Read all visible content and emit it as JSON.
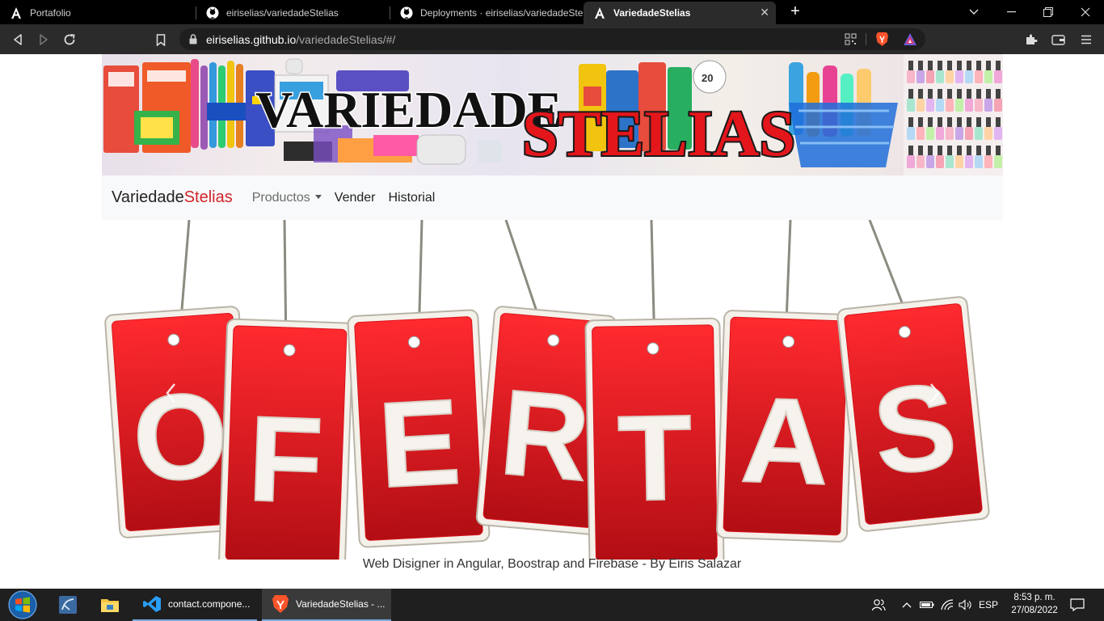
{
  "browser": {
    "tabs": [
      {
        "title": "Portafolio",
        "icon": "angular-icon",
        "active": false
      },
      {
        "title": "eiriselias/variedadeStelias",
        "icon": "github-icon",
        "active": false
      },
      {
        "title": "Deployments · eiriselias/variedadeStelias",
        "icon": "github-icon",
        "active": false
      },
      {
        "title": "VariedadeStelias",
        "icon": "angular-icon",
        "active": true
      }
    ],
    "url_host": "eiriselias.github.io",
    "url_path": "/variedadeStelias/#/"
  },
  "page": {
    "banner": {
      "word1": "VARIEDADE",
      "word2": "STELIAS",
      "small_label": "20"
    },
    "navbar": {
      "brand_main": "Variedade",
      "brand_accent": "Stelias",
      "links": [
        {
          "label": "Productos",
          "dropdown": true
        },
        {
          "label": "Vender",
          "dropdown": false
        },
        {
          "label": "Historial",
          "dropdown": false
        }
      ]
    },
    "carousel": {
      "letters": [
        "O",
        "F",
        "E",
        "R",
        "T",
        "A",
        "S"
      ]
    },
    "footer": "Web Disigner in Angular, Boostrap and Firebase - By Eiris Salazar"
  },
  "taskbar": {
    "apps": [
      {
        "label": "contact.compone...",
        "icon": "vscode-icon",
        "active": false
      },
      {
        "label": "VariedadeStelias - ...",
        "icon": "brave-icon",
        "active": true
      }
    ],
    "language": "ESP",
    "time": "8:53 p. m.",
    "date": "27/08/2022"
  },
  "colors": {
    "accent_red": "#d0242a",
    "tag_red": "#d8151b",
    "taskbar": "#1f1f1f",
    "toolbar": "#2b2b2b"
  }
}
